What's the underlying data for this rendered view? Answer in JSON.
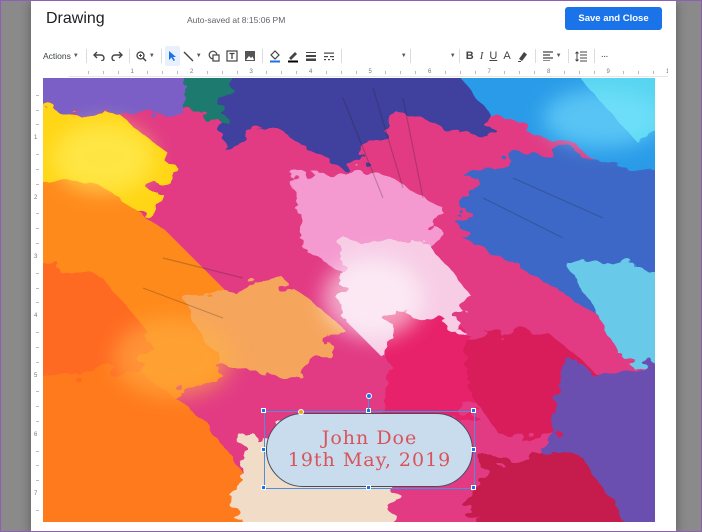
{
  "dialog": {
    "title": "Drawing",
    "autosave_text": "Auto-saved at 8:15:06 PM",
    "save_button_label": "Save and Close"
  },
  "toolbar": {
    "actions_label": "Actions",
    "icons": [
      "undo-icon",
      "redo-icon",
      "zoom-icon",
      "select-icon",
      "line-icon",
      "shape-icon",
      "text-box-icon",
      "image-icon",
      "fill-color-icon",
      "line-color-icon",
      "line-weight-icon",
      "line-dash-icon",
      "font-dropdown",
      "font-size-dropdown",
      "bold-icon",
      "italic-icon",
      "underline-icon",
      "text-color-icon",
      "highlight-icon",
      "align-icon",
      "line-spacing-icon",
      "more-icon"
    ],
    "bold_glyph": "B",
    "italic_glyph": "I",
    "underline_glyph": "U",
    "textcolor_glyph": "A",
    "more_glyph": "···"
  },
  "ruler": {
    "horizontal_labels": [
      "1",
      "2",
      "3",
      "4",
      "5",
      "6",
      "7",
      "8",
      "9",
      "10"
    ],
    "vertical_labels": [
      "1",
      "2",
      "3",
      "4",
      "5",
      "6",
      "7"
    ]
  },
  "text_bubble": {
    "line1": "John Doe",
    "line2": "19th May, 2019",
    "fill_color": "#c8dced",
    "text_color": "#d9535b"
  },
  "colors": {
    "accent": "#1a73e8",
    "window_border": "#8e5fb4"
  }
}
